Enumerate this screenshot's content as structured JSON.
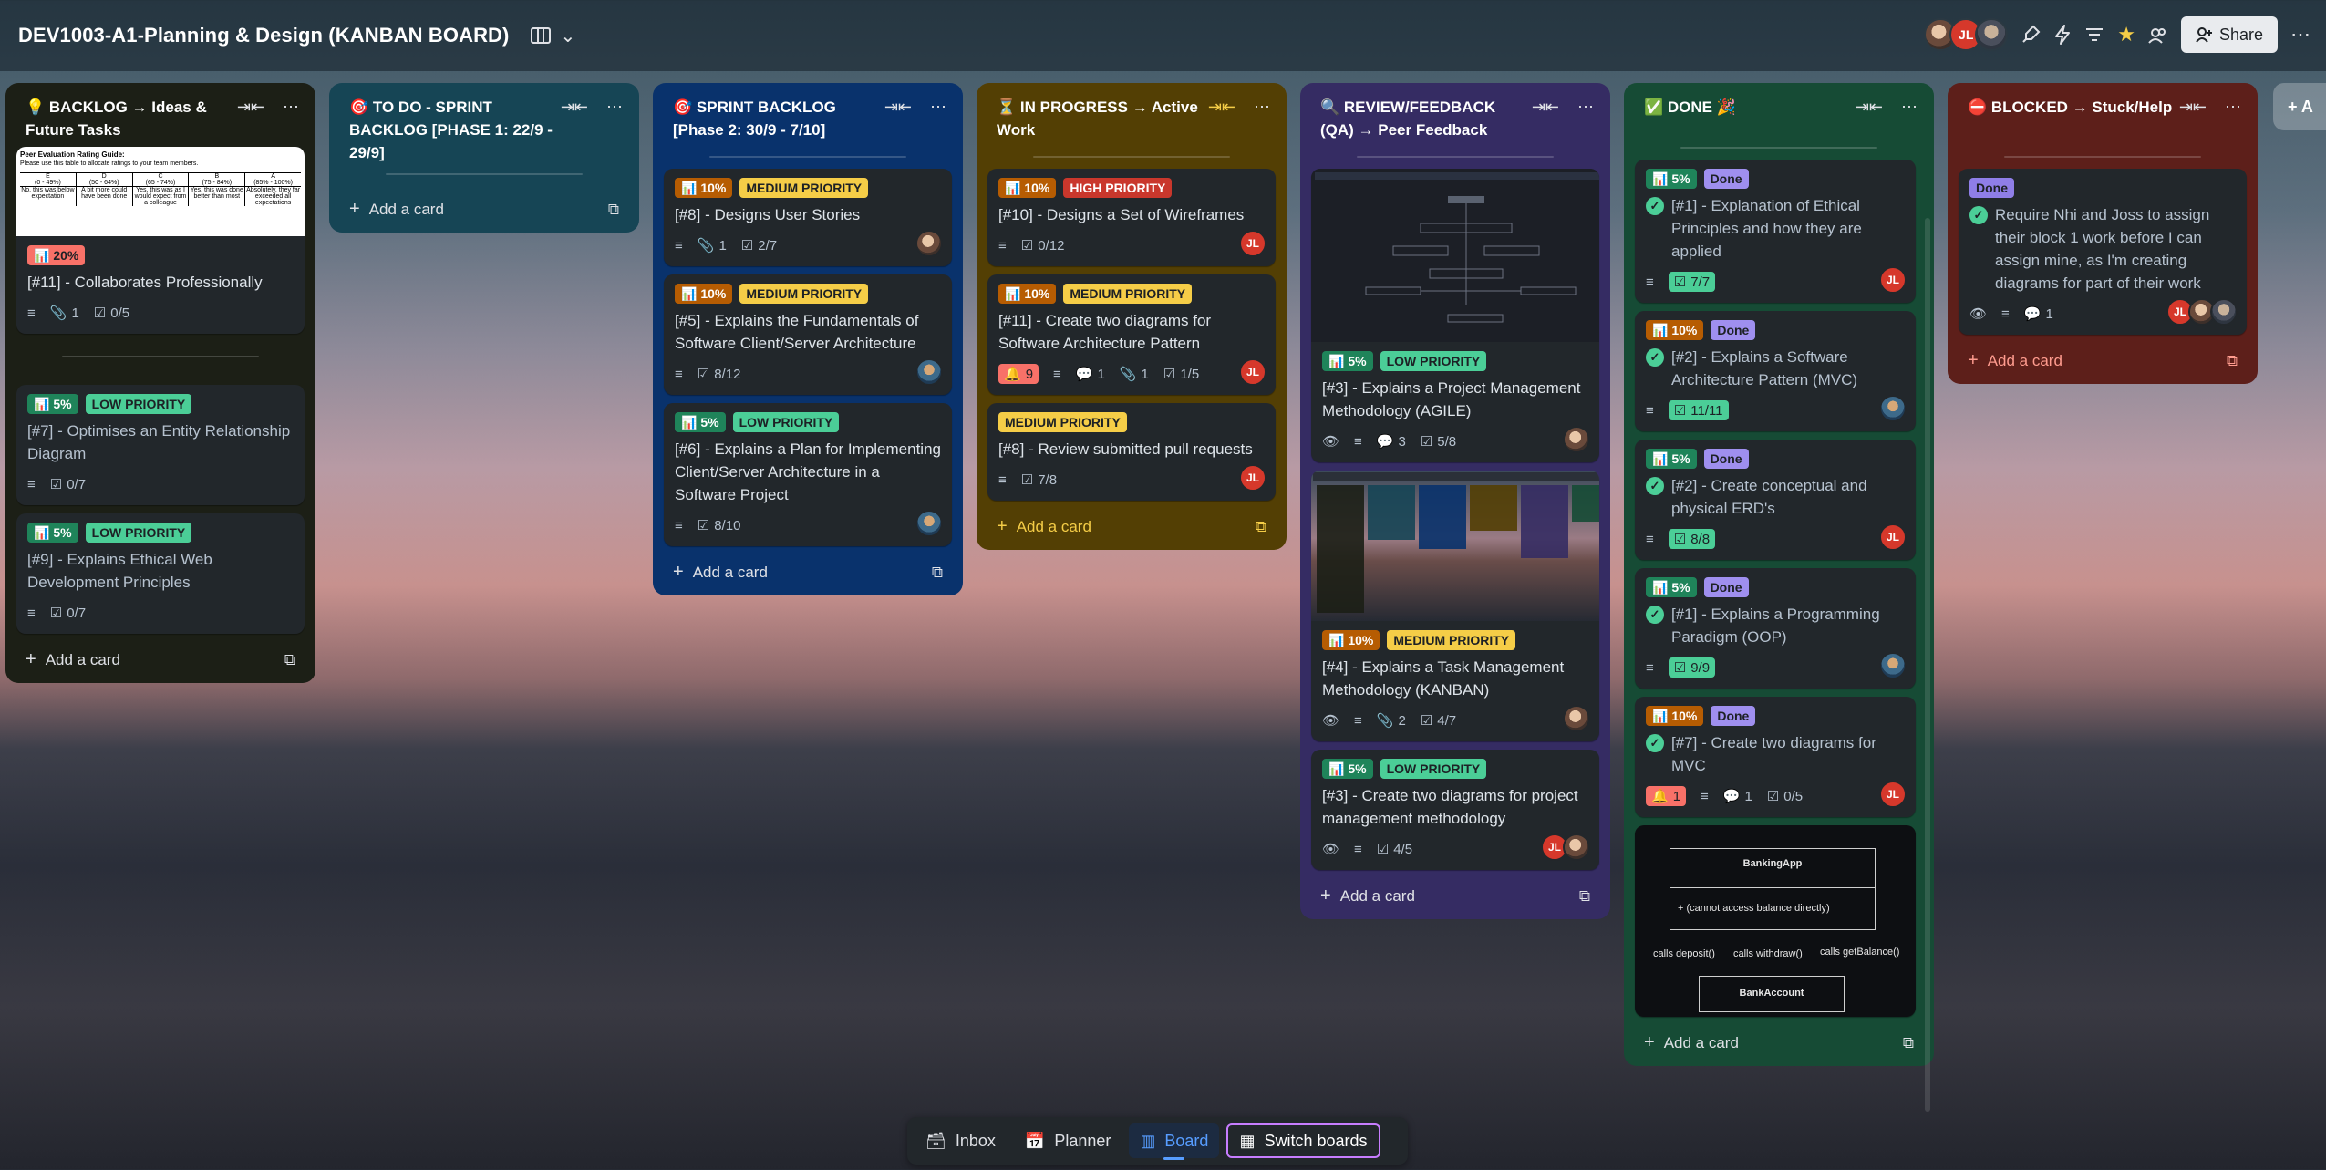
{
  "board": {
    "title": "DEV1003-A1-Planning & Design (KANBAN BOARD)",
    "share_label": "Share",
    "avatar_initials": "JL"
  },
  "lists": [
    {
      "title": "💡 BACKLOG → Ideas & Future Tasks",
      "color": "#1c1f16",
      "cards": [
        {
          "cover": "rubric",
          "cover_text": {
            "heading": "Peer Evaluation Rating Guide:",
            "sub": "Please use this table to allocate ratings to your team members.",
            "cols": [
              [
                "E",
                "(0 - 49%)",
                "No, this was below expectation"
              ],
              [
                "D",
                "(50 - 64%)",
                "A bit more could have been done"
              ],
              [
                "C",
                "(65 - 74%)",
                "Yes, this was as I would expect from a colleague"
              ],
              [
                "B",
                "(75 - 84%)",
                "Yes, this was done better than most"
              ],
              [
                "A",
                "(85% - 100%)",
                "Absolutely, they far exceeded all expectations"
              ]
            ]
          },
          "pct": "📊 20%",
          "title": "[#11] - Collaborates Professionally",
          "attach": "1",
          "checks": "0/5"
        },
        {
          "pct": "📊 5%",
          "priority": "LOW PRIORITY",
          "title": "[#7] - Optimises an Entity Relationship Diagram",
          "checks": "0/7"
        },
        {
          "pct": "📊 5%",
          "priority": "LOW PRIORITY",
          "title": "[#9] - Explains Ethical Web Development Principles",
          "checks": "0/7"
        }
      ],
      "add": "Add a card"
    },
    {
      "title": "🎯 TO DO - SPRINT BACKLOG [PHASE 1: 22/9 - 29/9]",
      "color": "#164555",
      "add": "Add a card"
    },
    {
      "title": "🎯 SPRINT BACKLOG [Phase 2: 30/9 - 7/10]",
      "color": "#09326c",
      "cards": [
        {
          "pct": "📊 10%",
          "priority": "MEDIUM PRIORITY",
          "title": "[#8] - Designs User Stories",
          "attach": "1",
          "checks": "2/7"
        },
        {
          "pct": "📊 10%",
          "priority": "MEDIUM PRIORITY",
          "title": "[#5] - Explains the Fundamentals of Software Client/Server Architecture",
          "checks": "8/12"
        },
        {
          "pct": "📊 5%",
          "priority": "LOW PRIORITY",
          "title": "[#6] - Explains a Plan for Implementing Client/Server Architecture in a Software Project",
          "checks": "8/10"
        }
      ],
      "add": "Add a card"
    },
    {
      "title": "⏳ IN PROGRESS → Active Work",
      "color": "#533f04",
      "cards": [
        {
          "pct": "📊 10%",
          "priority": "HIGH PRIORITY",
          "title": "[#10] - Designs a Set of Wireframes",
          "checks": "0/12"
        },
        {
          "pct": "📊 10%",
          "priority": "MEDIUM PRIORITY",
          "title": "[#11] - Create two diagrams for Software Architecture Pattern",
          "notif": "9",
          "comments": "1",
          "attach": "1",
          "checks": "1/5"
        },
        {
          "priority": "MEDIUM PRIORITY",
          "title": "[#8] - Review submitted pull requests",
          "checks": "7/8"
        }
      ],
      "add": "Add a card"
    },
    {
      "title": "🔍 REVIEW/FEEDBACK (QA) → Peer Feedback",
      "color": "#352c63",
      "cards": [
        {
          "pct": "📊 5%",
          "priority": "LOW PRIORITY",
          "title": "[#3] - Explains a Project Management Methodology (AGILE)",
          "comments": "3",
          "checks": "5/8"
        },
        {
          "pct": "📊 10%",
          "priority": "MEDIUM PRIORITY",
          "title": "[#4] - Explains a Task Management Methodology (KANBAN)",
          "attach": "2",
          "checks": "4/7"
        },
        {
          "pct": "📊 5%",
          "priority": "LOW PRIORITY",
          "title": "[#3] - Create two diagrams for project management methodology",
          "checks": "4/5"
        }
      ],
      "add": "Add a card"
    },
    {
      "title": "✅ DONE 🎉",
      "color": "#164b35",
      "cards": [
        {
          "pct": "📊 5%",
          "label": "Done",
          "title": "[#1] - Explanation of Ethical Principles and how they are applied",
          "checks": "7/7"
        },
        {
          "pct": "📊 10%",
          "label": "Done",
          "title": "[#2] - Explains a Software Architecture Pattern (MVC)",
          "checks": "11/11"
        },
        {
          "pct": "📊 5%",
          "label": "Done",
          "title": "[#2] - Create conceptual and physical ERD's",
          "checks": "8/8"
        },
        {
          "pct": "📊 5%",
          "label": "Done",
          "title": "[#1] - Explains a Programming Paradigm (OOP)",
          "checks": "9/9"
        },
        {
          "pct": "📊 10%",
          "label": "Done",
          "title": "[#7] - Create two diagrams for MVC",
          "notif": "1",
          "comments": "1",
          "checks": "0/5"
        },
        {
          "cover": "uml",
          "uml": {
            "top": "BankingApp",
            "note": "+ (cannot access balance directly)",
            "calls": [
              "calls deposit()",
              "calls withdraw()",
              "calls getBalance()"
            ],
            "bottom": "BankAccount"
          }
        }
      ],
      "add": "Add a card"
    },
    {
      "title": "⛔ BLOCKED → Stuck/Help",
      "color": "#5d1f1a",
      "cards": [
        {
          "label": "Done",
          "title": "Require Nhi and Joss to assign their block 1 work before I can assign mine, as I'm creating diagrams for part of their work",
          "comments": "1"
        }
      ],
      "add": "Add a card"
    }
  ],
  "add_list_label": "+ A",
  "bottom_nav": {
    "inbox": "Inbox",
    "planner": "Planner",
    "board": "Board",
    "switch": "Switch boards"
  },
  "icons": [
    "board-icon",
    "chevron-down-icon",
    "star-icon",
    "share-icon",
    "more-icon",
    "collapse-icon",
    "description-icon",
    "attachment-icon",
    "checklist-icon",
    "comment-icon",
    "watch-icon",
    "bell-icon",
    "card-template-icon",
    "inbox-icon",
    "calendar-icon"
  ]
}
